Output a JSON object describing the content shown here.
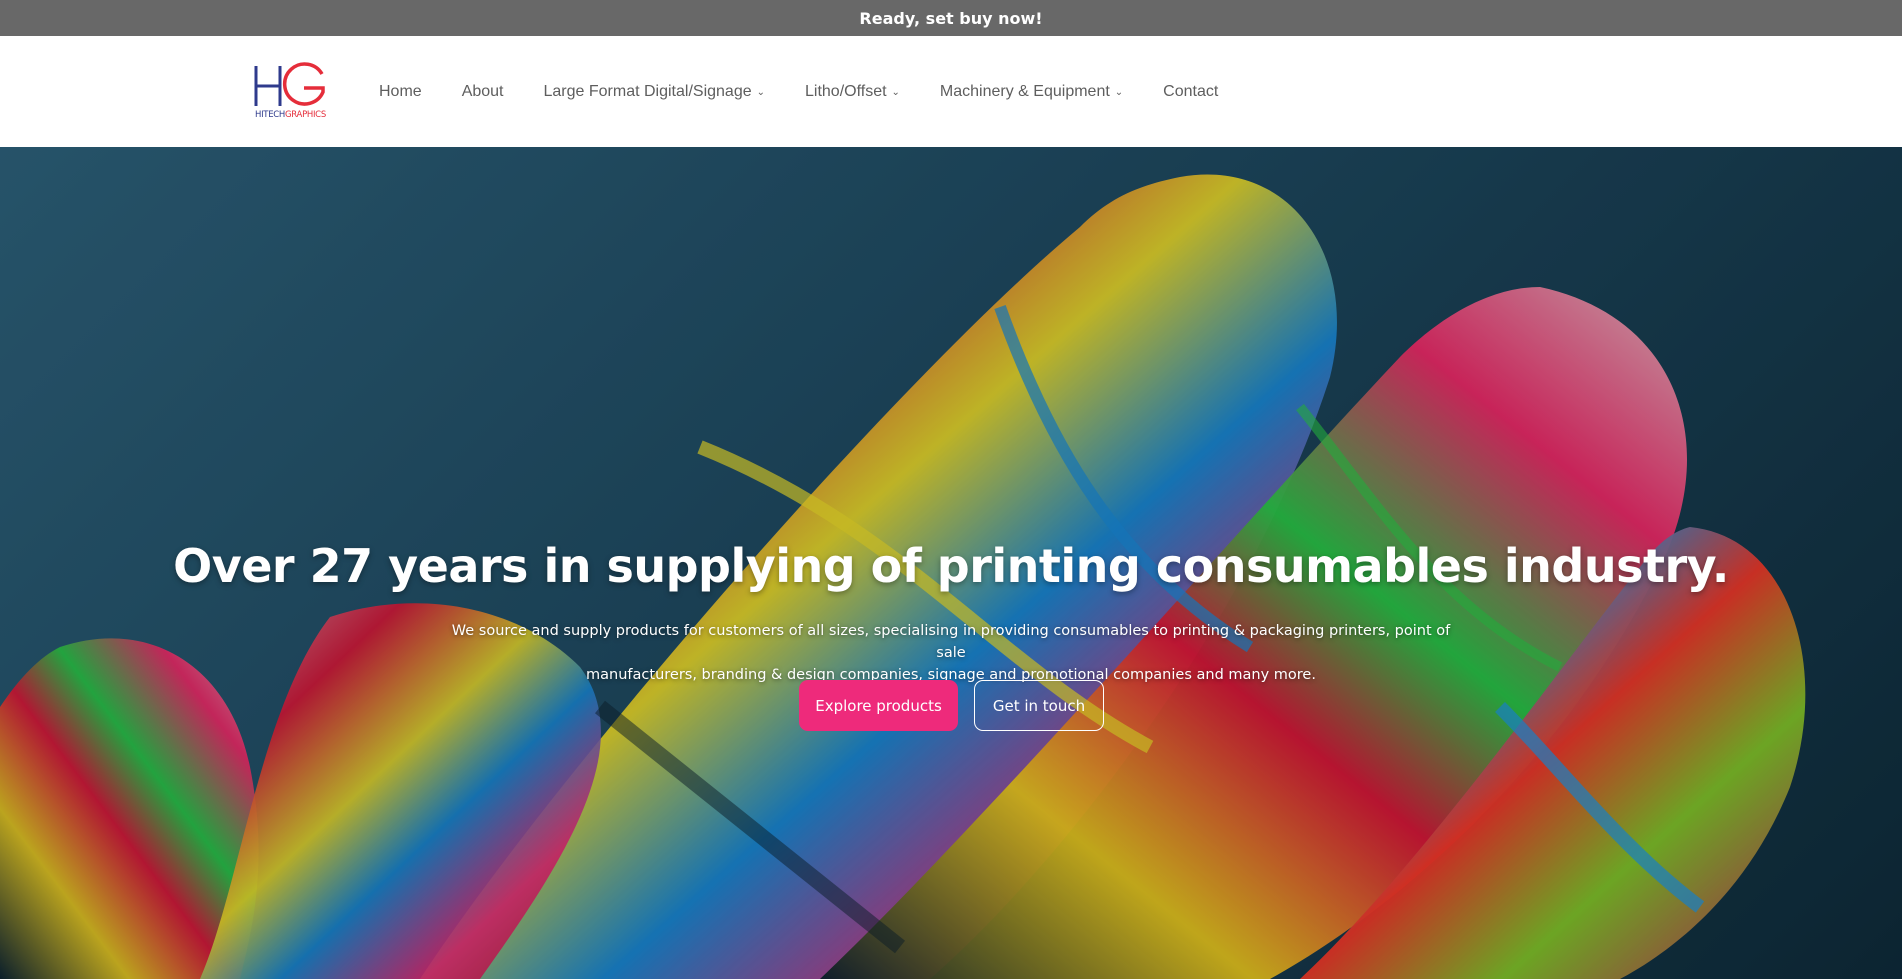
{
  "announcement": "Ready, set buy now!",
  "brand": {
    "logo_part1": "HITECH",
    "logo_part2": "GRAPHICS",
    "primary_color": "#2e3a8c",
    "accent_color": "#e52d3a"
  },
  "nav": {
    "items": [
      {
        "label": "Home",
        "dropdown": false
      },
      {
        "label": "About",
        "dropdown": false
      },
      {
        "label": "Large Format Digital/Signage",
        "dropdown": true
      },
      {
        "label": "Litho/Offset",
        "dropdown": true
      },
      {
        "label": "Machinery & Equipment",
        "dropdown": true
      },
      {
        "label": "Contact",
        "dropdown": false
      }
    ],
    "chevron_icon": "chevron-down-icon"
  },
  "hero": {
    "title": "Over 27 years in supplying of printing consumables industry.",
    "subtitle_line1": "We source and supply products for customers of all sizes, specialising in providing consumables to printing & packaging printers, point of sale",
    "subtitle_line2": "manufacturers, branding & design companies, signage and promotional companies and many more.",
    "primary_button": "Explore products",
    "secondary_button": "Get in touch",
    "button_color": "#ee2a7b"
  }
}
